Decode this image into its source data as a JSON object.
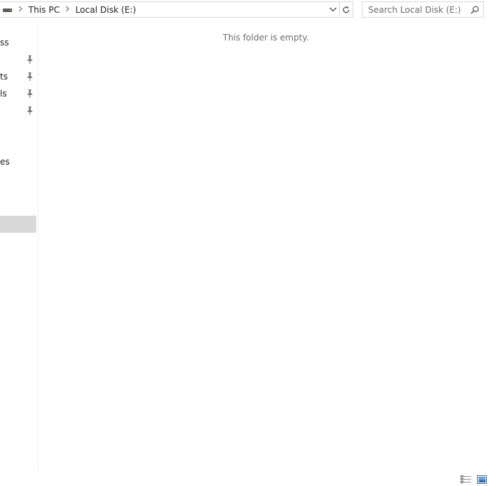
{
  "address_bar": {
    "breadcrumbs": [
      "This PC",
      "Local Disk (E:)"
    ]
  },
  "search": {
    "placeholder": "Search Local Disk (E:)"
  },
  "nav_pane": {
    "items": [
      {
        "label": "ss",
        "pinned": false
      },
      {
        "label": "",
        "pinned": true
      },
      {
        "label": "ts",
        "pinned": true
      },
      {
        "label": "ls",
        "pinned": true
      },
      {
        "label": "",
        "pinned": true
      },
      {
        "label": "es",
        "pinned": false
      },
      {
        "label": "",
        "selected": true
      }
    ]
  },
  "content": {
    "empty_message": "This folder is empty."
  },
  "status_bar": {
    "views": [
      "details-view-icon",
      "large-icons-view-icon"
    ]
  }
}
